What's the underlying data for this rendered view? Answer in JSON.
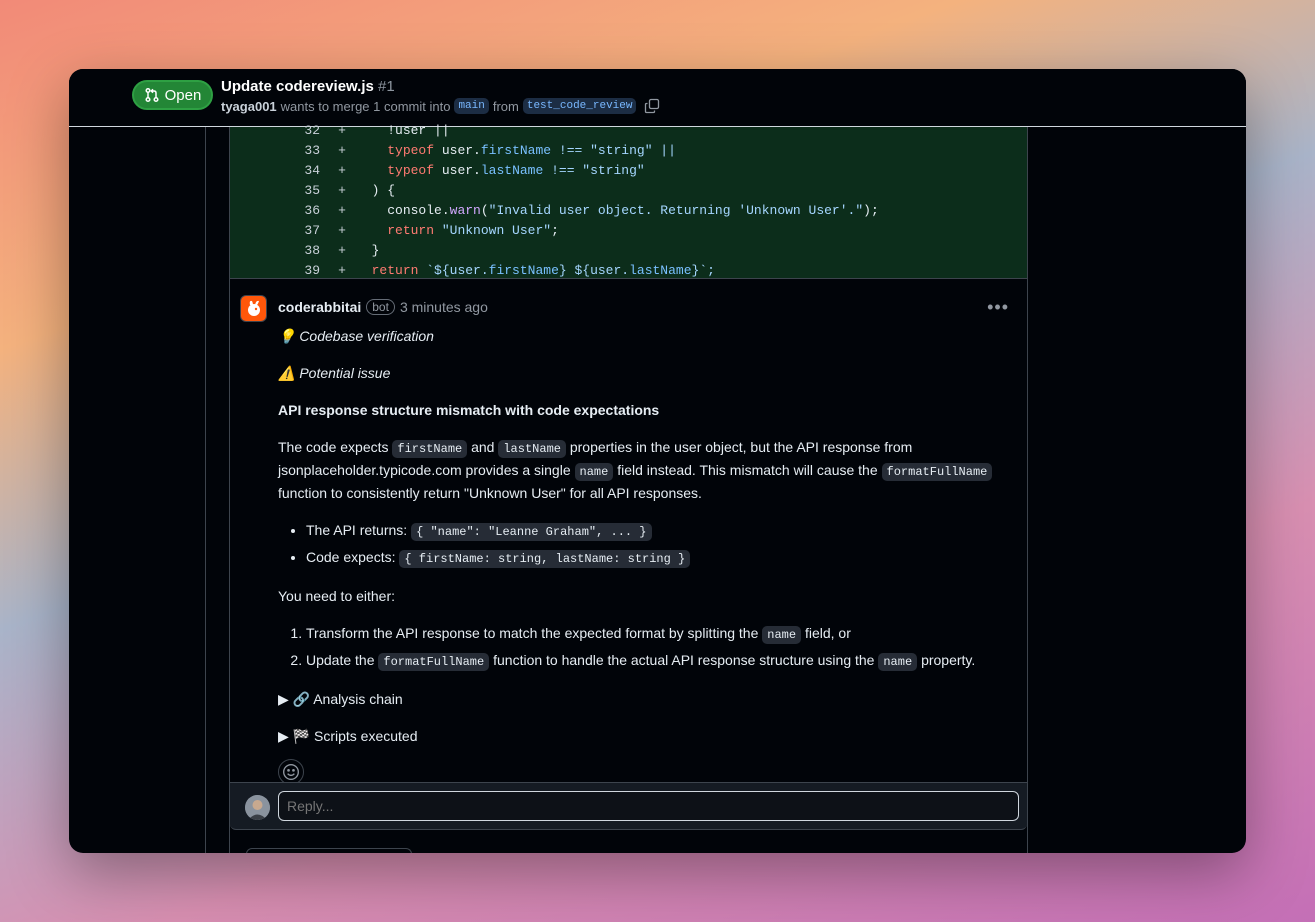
{
  "header": {
    "status_label": "Open",
    "title": "Update codereview.js",
    "number": "#1",
    "author": "tyaga001",
    "merge_text": "wants to merge 1 commit into",
    "base_branch": "main",
    "from_text": "from",
    "head_branch": "test_code_review"
  },
  "diff": {
    "lines": [
      {
        "num": "32",
        "sign": "+"
      },
      {
        "num": "33",
        "sign": "+"
      },
      {
        "num": "34",
        "sign": "+"
      },
      {
        "num": "35",
        "sign": "+"
      },
      {
        "num": "36",
        "sign": "+"
      },
      {
        "num": "37",
        "sign": "+"
      },
      {
        "num": "38",
        "sign": "+"
      },
      {
        "num": "39",
        "sign": "+"
      }
    ],
    "code": {
      "l32": "!user ||",
      "l33_kw": "typeof",
      "l33_obj": "user.",
      "l33_prop": "firstName",
      "l33_rest": "!== \"string\" ||",
      "l34_kw": "typeof",
      "l34_obj": "user.",
      "l34_prop": "lastName",
      "l34_rest": "!== \"string\"",
      "l35": ") {",
      "l36_obj": "console.",
      "l36_fn": "warn",
      "l36_open": "(",
      "l36_str": "\"Invalid user object. Returning 'Unknown User'.\"",
      "l36_close": ");",
      "l37_kw": "return",
      "l37_str": "\"Unknown User\"",
      "l37_end": ";",
      "l38": "}",
      "l39_kw": "return",
      "l39_a": "`${user.",
      "l39_p1": "firstName",
      "l39_b": "} ${user.",
      "l39_p2": "lastName",
      "l39_c": "}`;"
    }
  },
  "comment": {
    "author": "coderabbitai",
    "badge": "bot",
    "time": "3 minutes ago",
    "verification": "💡 Codebase verification",
    "potential": "⚠️ Potential issue",
    "heading": "API response structure mismatch with code expectations",
    "p1_a": "The code expects",
    "p1_code1": "firstName",
    "p1_b": "and",
    "p1_code2": "lastName",
    "p1_c": "properties in the user object, but the API response from jsonplaceholder.typicode.com provides a single",
    "p1_code3": "name",
    "p1_d": "field instead. This mismatch will cause the",
    "p1_code4": "formatFullName",
    "p1_e": "function to consistently return \"Unknown User\" for all API responses.",
    "bullet1_label": "The API returns:",
    "bullet1_code": "{ \"name\": \"Leanne Graham\", ... }",
    "bullet2_label": "Code expects:",
    "bullet2_code": "{ firstName: string, lastName: string }",
    "need": "You need to either:",
    "ol1_a": "Transform the API response to match the expected format by splitting the",
    "ol1_code": "name",
    "ol1_b": "field, or",
    "ol2_a": "Update the",
    "ol2_code1": "formatFullName",
    "ol2_b": "function to handle the actual API response structure using the",
    "ol2_code2": "name",
    "ol2_c": "property.",
    "details1": "▶ 🔗 Analysis chain",
    "details2": "▶ 🏁 Scripts executed"
  },
  "reply": {
    "placeholder": "Reply..."
  },
  "colors": {
    "accent_green": "#238636",
    "diff_bg": "#0c2d1b",
    "bg": "#010409"
  }
}
